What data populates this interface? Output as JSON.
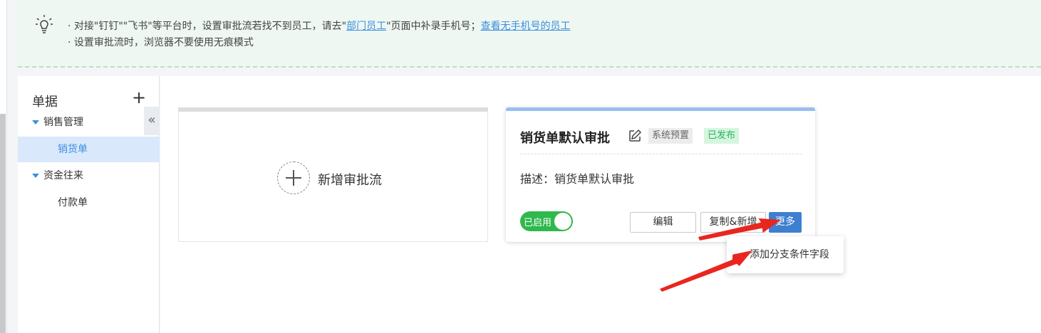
{
  "notice": {
    "line1_prefix": "· 对接\"钉钉\"\"飞书\"等平台时，设置审批流若找不到员工，请去\"",
    "line1_link1": "部门员工",
    "line1_middle": "\"页面中补录手机号；",
    "line1_link2": "查看无手机号的员工",
    "line2": "· 设置审批流时，浏览器不要使用无痕模式"
  },
  "sidebar": {
    "title": "单据",
    "add_label": "+",
    "collapse_label": "«",
    "groups": [
      {
        "label": "销售管理",
        "children": [
          {
            "label": "销货单",
            "active": true
          }
        ]
      },
      {
        "label": "资金往来",
        "children": [
          {
            "label": "付款单",
            "active": false
          }
        ]
      }
    ]
  },
  "new_card": {
    "label": "新增审批流"
  },
  "flow_card": {
    "name": "销货单默认审批",
    "tags": {
      "system": "系统预置",
      "published": "已发布"
    },
    "description": "描述：销货单默认审批",
    "toggle_label": "已启用",
    "buttons": {
      "edit": "编辑",
      "copy": "复制&新增",
      "more": "更多"
    }
  },
  "more_menu": {
    "items": [
      "添加分支条件字段"
    ]
  },
  "colors": {
    "accent": "#3b8fe0",
    "notice_bg": "#eef7f2",
    "toggle_on": "#2fb84c",
    "published_tag": "#27b45e",
    "more_button": "#3e7fd0",
    "annotation_arrow": "#e8261f"
  },
  "icons": {
    "notice": "lightbulb-icon",
    "edit": "pencil-edit-icon",
    "expand": "caret-down-icon",
    "add": "plus-icon"
  }
}
